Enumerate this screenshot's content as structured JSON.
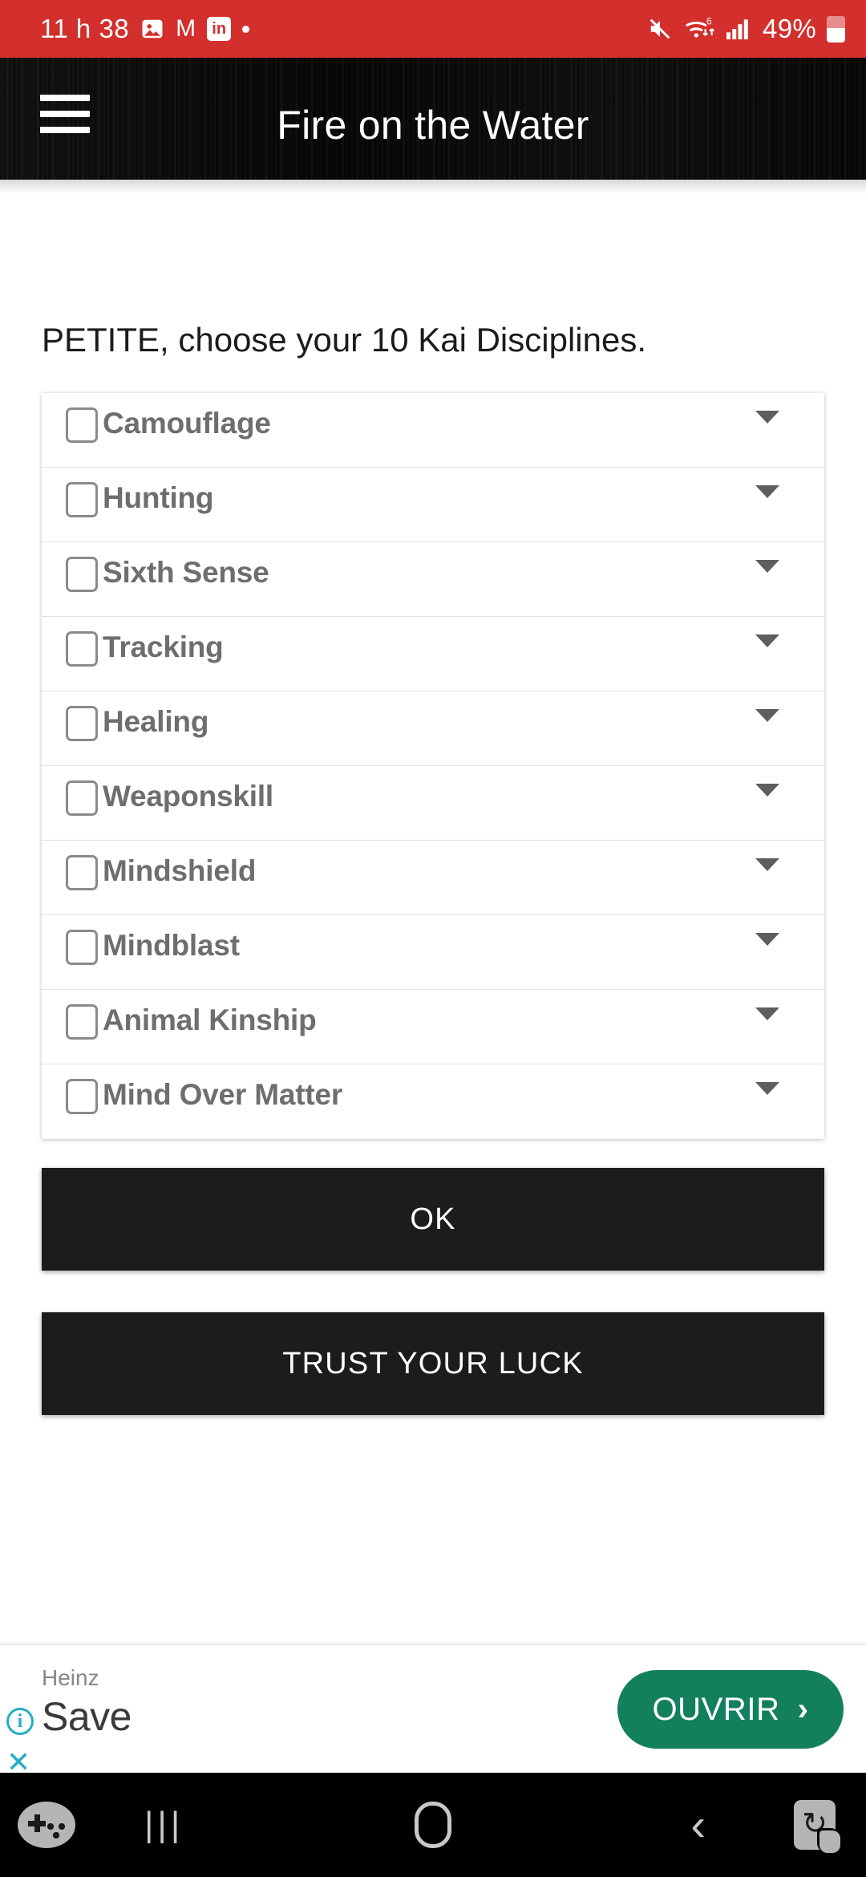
{
  "status_bar": {
    "time": "11 h 38",
    "icons_left": [
      "image-icon",
      "gmail-icon",
      "linkedin-icon",
      "dot-indicator"
    ],
    "linkedin_label": "in",
    "gmail_label": "M",
    "icons_right": [
      "mute-icon",
      "wifi-icon",
      "signal-icon"
    ],
    "wifi_badge": "6",
    "battery_percent": "49%",
    "background_color": "#d32f2c"
  },
  "app_bar": {
    "title": "Fire on the Water",
    "menu_icon": "hamburger-menu-icon",
    "background_color": "#0a0a0a"
  },
  "main": {
    "prompt": "PETITE, choose your 10 Kai Disciplines.",
    "disciplines": [
      {
        "label": "Camouflage",
        "checked": false
      },
      {
        "label": "Hunting",
        "checked": false
      },
      {
        "label": "Sixth Sense",
        "checked": false
      },
      {
        "label": "Tracking",
        "checked": false
      },
      {
        "label": "Healing",
        "checked": false
      },
      {
        "label": "Weaponskill",
        "checked": false
      },
      {
        "label": "Mindshield",
        "checked": false
      },
      {
        "label": "Mindblast",
        "checked": false
      },
      {
        "label": "Animal Kinship",
        "checked": false
      },
      {
        "label": "Mind Over Matter",
        "checked": false
      }
    ],
    "ok_button": "OK",
    "luck_button": "TRUST YOUR LUCK",
    "button_color": "#1c1c1c"
  },
  "ad": {
    "advertiser": "Heinz",
    "headline": "Save",
    "cta_label": "OUVRIR",
    "cta_chevron": "›",
    "cta_color": "#12805c",
    "info_icon": "info-icon",
    "info_glyph": "i",
    "close_icon": "close-icon",
    "close_glyph": "✕",
    "accent_color": "#24aec4"
  },
  "nav_bar": {
    "game_booster_icon": "game-booster-icon",
    "recents_icon": "recents-icon",
    "recents_glyph": "|||",
    "home_icon": "home-icon",
    "back_icon": "back-icon",
    "back_glyph": "‹",
    "rotate_icon": "screen-rotate-icon",
    "background_color": "#000000"
  }
}
